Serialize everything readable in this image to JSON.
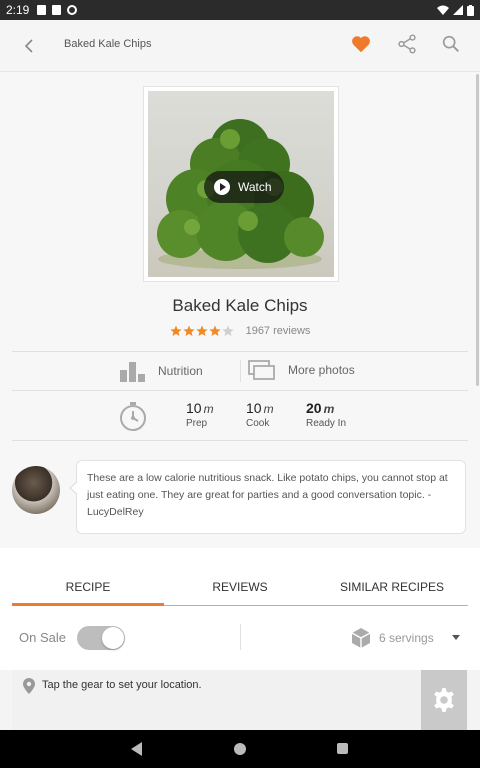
{
  "status_bar": {
    "time": "2:19"
  },
  "header": {
    "title": "Baked Kale Chips",
    "icons": [
      "back-arrow-icon",
      "heart-icon",
      "share-icon",
      "search-icon"
    ],
    "accent_color": "#f07a2c"
  },
  "recipe": {
    "watch_label": "Watch",
    "name": "Baked Kale Chips",
    "rating": 4.5,
    "reviews_text": "1967 reviews",
    "nutrition_label": "Nutrition",
    "more_photos_label": "More photos",
    "times": [
      {
        "value": "10",
        "unit": "m",
        "label": "Prep"
      },
      {
        "value": "10",
        "unit": "m",
        "label": "Cook"
      },
      {
        "value": "20",
        "unit": "m",
        "label": "Ready In"
      }
    ],
    "description": "These are a low calorie nutritious snack. Like potato chips, you cannot stop at just eating one. They are great for parties and a good conversation topic. - LucyDelRey"
  },
  "tabs": [
    {
      "label": "RECIPE",
      "active": true
    },
    {
      "label": "REVIEWS",
      "active": false
    },
    {
      "label": "SIMILAR RECIPES",
      "active": false
    }
  ],
  "options": {
    "on_sale_label": "On Sale",
    "on_sale_enabled": true,
    "servings_label": "6 servings"
  },
  "location": {
    "message": "Tap the gear to set your location."
  }
}
